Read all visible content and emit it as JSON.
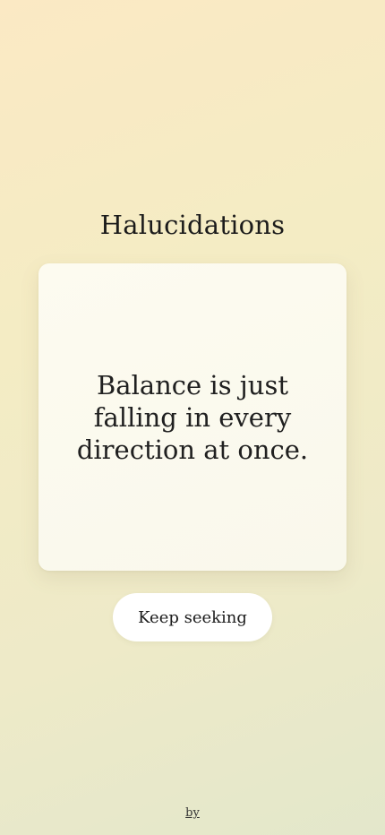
{
  "app": {
    "title": "Halucidations"
  },
  "card": {
    "quote": "Balance is just falling in every direction at once."
  },
  "actions": {
    "primary_label": "Keep seeking"
  },
  "footer": {
    "by_label": "by"
  },
  "colors": {
    "background_start": "#fbe9c4",
    "background_end": "#e3e7cb",
    "card_background": "#fdfbf0",
    "button_background": "#ffffff",
    "text": "#1b1b1b"
  }
}
